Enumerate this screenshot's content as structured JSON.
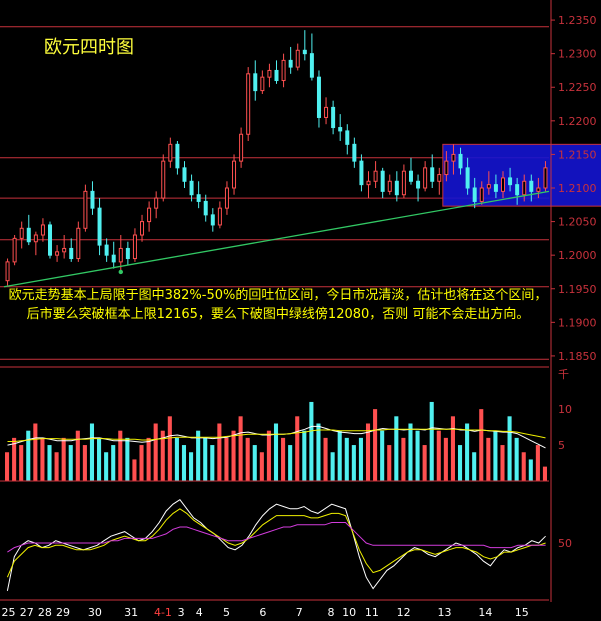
{
  "title": "欧元四时图",
  "commentary": "欧元走势基本上局限于图中382%-50%的回吐位区间，今日市况清淡，估计也将在这个区间，后市要么突破框本上限12165，要么下破图中绿线傍12080，否则 可能不会走出方向。",
  "colors": {
    "background": "#000000",
    "axis": "#c8323c",
    "up": "#ff5050",
    "down": "#50f0f0",
    "box_fill": "#1414d2",
    "trendline": "#32c864",
    "circles": "#f5e68c",
    "text": "#ffff00",
    "osc_white": "#ffffff",
    "osc_yellow": "#f0f000",
    "osc_magenta": "#d23cdc"
  },
  "chart_data": [
    {
      "type": "candlestick",
      "panel": "price",
      "y_ticks": [
        "1.2350",
        "1.2300",
        "1.2250",
        "1.2200",
        "1.2150",
        "1.2100",
        "1.2050",
        "1.2000",
        "1.1950",
        "1.1900",
        "1.1850"
      ],
      "ylim": [
        1.1835,
        1.2365
      ],
      "horizontal_levels": [
        1.234,
        1.2145,
        1.2085,
        1.2023,
        1.1953,
        1.1845
      ],
      "range_box": {
        "top": 1.2165,
        "bottom": 1.2073,
        "x_start": 61.5,
        "x_end": 87.5
      },
      "trendline": {
        "start": [
          0,
          1.1953
        ],
        "end": [
          100,
          1.2095
        ]
      },
      "trendline_point": [
        16,
        1.1975
      ],
      "circles": [
        [
          87.5,
          1.217
        ],
        [
          87.5,
          1.2075
        ]
      ],
      "candles": [
        [
          1.1962,
          1.1995,
          1.1955,
          1.199
        ],
        [
          1.199,
          1.203,
          1.1985,
          1.2025
        ],
        [
          1.2025,
          1.205,
          1.201,
          1.204
        ],
        [
          1.204,
          1.206,
          1.2015,
          1.202
        ],
        [
          1.202,
          1.2035,
          1.2,
          1.203
        ],
        [
          1.203,
          1.2055,
          1.202,
          1.2045
        ],
        [
          1.2045,
          1.205,
          1.1995,
          1.2
        ],
        [
          1.2,
          1.2015,
          1.199,
          1.2005
        ],
        [
          1.2005,
          1.203,
          1.1995,
          1.201
        ],
        [
          1.201,
          1.2025,
          1.199,
          1.1995
        ],
        [
          1.1995,
          1.205,
          1.199,
          1.204
        ],
        [
          1.204,
          1.2105,
          1.2035,
          1.2095
        ],
        [
          1.2095,
          1.211,
          1.206,
          1.207
        ],
        [
          1.207,
          1.2085,
          1.2,
          1.2015
        ],
        [
          1.2015,
          1.2025,
          1.199,
          1.2
        ],
        [
          1.2,
          1.202,
          1.198,
          1.199
        ],
        [
          1.199,
          1.203,
          1.1975,
          1.201
        ],
        [
          1.201,
          1.202,
          1.1985,
          1.1995
        ],
        [
          1.1995,
          1.204,
          1.199,
          1.203
        ],
        [
          1.203,
          1.206,
          1.202,
          1.205
        ],
        [
          1.205,
          1.208,
          1.2035,
          1.207
        ],
        [
          1.207,
          1.2095,
          1.2055,
          1.2085
        ],
        [
          1.2085,
          1.215,
          1.208,
          1.214
        ],
        [
          1.214,
          1.2175,
          1.213,
          1.2165
        ],
        [
          1.2165,
          1.217,
          1.212,
          1.213
        ],
        [
          1.213,
          1.214,
          1.21,
          1.211
        ],
        [
          1.211,
          1.212,
          1.208,
          1.209
        ],
        [
          1.209,
          1.211,
          1.207,
          1.208
        ],
        [
          1.208,
          1.209,
          1.205,
          1.206
        ],
        [
          1.206,
          1.207,
          1.2035,
          1.2045
        ],
        [
          1.2045,
          1.208,
          1.204,
          1.207
        ],
        [
          1.207,
          1.211,
          1.206,
          1.21
        ],
        [
          1.21,
          1.215,
          1.209,
          1.214
        ],
        [
          1.214,
          1.219,
          1.213,
          1.218
        ],
        [
          1.218,
          1.228,
          1.217,
          1.227
        ],
        [
          1.227,
          1.229,
          1.223,
          1.2245
        ],
        [
          1.2245,
          1.2275,
          1.224,
          1.2265
        ],
        [
          1.2265,
          1.2285,
          1.225,
          1.2275
        ],
        [
          1.2275,
          1.229,
          1.2255,
          1.226
        ],
        [
          1.226,
          1.23,
          1.225,
          1.229
        ],
        [
          1.229,
          1.231,
          1.227,
          1.228
        ],
        [
          1.228,
          1.2315,
          1.2275,
          1.2305
        ],
        [
          1.2305,
          1.2335,
          1.229,
          1.23
        ],
        [
          1.23,
          1.233,
          1.226,
          1.2265
        ],
        [
          1.2265,
          1.2275,
          1.219,
          1.2205
        ],
        [
          1.2205,
          1.2235,
          1.2195,
          1.222
        ],
        [
          1.222,
          1.223,
          1.218,
          1.219
        ],
        [
          1.219,
          1.221,
          1.217,
          1.2185
        ],
        [
          1.2185,
          1.2195,
          1.215,
          1.2165
        ],
        [
          1.2165,
          1.2175,
          1.213,
          1.214
        ],
        [
          1.214,
          1.215,
          1.2095,
          1.2105
        ],
        [
          1.2105,
          1.2125,
          1.2085,
          1.211
        ],
        [
          1.211,
          1.214,
          1.21,
          1.2125
        ],
        [
          1.2125,
          1.213,
          1.2085,
          1.2095
        ],
        [
          1.2095,
          1.212,
          1.209,
          1.211
        ],
        [
          1.211,
          1.2125,
          1.208,
          1.209
        ],
        [
          1.209,
          1.2135,
          1.2085,
          1.2125
        ],
        [
          1.2125,
          1.2145,
          1.2105,
          1.211
        ],
        [
          1.211,
          1.212,
          1.208,
          1.21
        ],
        [
          1.21,
          1.214,
          1.2095,
          1.213
        ],
        [
          1.213,
          1.215,
          1.21,
          1.211
        ],
        [
          1.211,
          1.213,
          1.209,
          1.212
        ],
        [
          1.212,
          1.2155,
          1.211,
          1.214
        ],
        [
          1.214,
          1.2165,
          1.212,
          1.215
        ],
        [
          1.215,
          1.216,
          1.212,
          1.213
        ],
        [
          1.213,
          1.2145,
          1.209,
          1.21
        ],
        [
          1.21,
          1.2115,
          1.207,
          1.208
        ],
        [
          1.208,
          1.211,
          1.2075,
          1.21
        ],
        [
          1.21,
          1.2125,
          1.209,
          1.2105
        ],
        [
          1.2105,
          1.212,
          1.2085,
          1.2095
        ],
        [
          1.2095,
          1.2125,
          1.2085,
          1.2115
        ],
        [
          1.2115,
          1.213,
          1.2095,
          1.2105
        ],
        [
          1.2105,
          1.2115,
          1.2075,
          1.209
        ],
        [
          1.209,
          1.212,
          1.208,
          1.211
        ],
        [
          1.211,
          1.212,
          1.208,
          1.2095
        ],
        [
          1.2095,
          1.2115,
          1.2085,
          1.21
        ],
        [
          1.21,
          1.214,
          1.2095,
          1.213
        ]
      ]
    },
    {
      "type": "bar",
      "panel": "volume",
      "y_ticks": [
        "千",
        "10",
        "5"
      ],
      "ylim": [
        0,
        16
      ],
      "values": [
        4,
        6,
        5,
        7,
        8,
        6,
        5,
        4,
        6,
        5,
        7,
        5,
        8,
        6,
        4,
        5,
        7,
        6,
        3,
        5,
        6,
        8,
        7,
        9,
        6,
        5,
        4,
        7,
        6,
        5,
        8,
        6,
        7,
        9,
        6,
        5,
        4,
        7,
        8,
        6,
        5,
        9,
        7,
        11,
        8,
        6,
        4,
        7,
        6,
        5,
        6,
        8,
        10,
        7,
        5,
        9,
        6,
        8,
        7,
        5,
        11,
        7,
        6,
        9,
        5,
        8,
        4,
        10,
        6,
        7,
        5,
        9,
        6,
        4,
        3,
        5,
        2
      ],
      "ma_white": [
        5,
        5.2,
        5.5,
        5.8,
        6,
        6,
        5.8,
        5.6,
        5.6,
        5.6,
        5.8,
        5.9,
        6,
        6,
        5.8,
        5.6,
        5.6,
        5.6,
        5.5,
        5.4,
        5.5,
        5.8,
        6,
        6.3,
        6.4,
        6.2,
        6,
        6,
        6,
        5.9,
        6,
        6.1,
        6.4,
        6.7,
        6.8,
        6.6,
        6.4,
        6.4,
        6.5,
        6.5,
        6.6,
        6.9,
        7.2,
        7.6,
        7.6,
        7.3,
        7,
        6.8,
        6.7,
        6.6,
        6.6,
        6.8,
        7.1,
        7.3,
        7.2,
        7.2,
        7.1,
        7.2,
        7.2,
        7.1,
        7.4,
        7.3,
        7.2,
        7.3,
        7.1,
        7.1,
        6.9,
        7.1,
        7,
        6.9,
        6.8,
        6.8,
        6.6,
        6.1,
        5.6,
        5.1,
        4.6
      ],
      "ma_yellow": [
        5.5,
        5.5,
        5.6,
        5.7,
        5.8,
        5.9,
        5.9,
        5.9,
        5.8,
        5.8,
        5.8,
        5.8,
        5.9,
        5.9,
        5.9,
        5.8,
        5.8,
        5.8,
        5.8,
        5.7,
        5.7,
        5.8,
        5.9,
        6,
        6.1,
        6.1,
        6.1,
        6.1,
        6.1,
        6.1,
        6.1,
        6.2,
        6.3,
        6.4,
        6.5,
        6.5,
        6.5,
        6.5,
        6.5,
        6.5,
        6.6,
        6.7,
        6.8,
        7,
        7.1,
        7.1,
        7.1,
        7,
        7,
        7,
        7,
        7,
        7.1,
        7.1,
        7.2,
        7.2,
        7.2,
        7.2,
        7.2,
        7.2,
        7.2,
        7.2,
        7.2,
        7.2,
        7.2,
        7.1,
        7.1,
        7.1,
        7,
        7,
        6.9,
        6.9,
        6.8,
        6.6,
        6.4,
        6.2,
        6
      ]
    },
    {
      "type": "line",
      "panel": "oscillator",
      "y_ticks": [
        "50"
      ],
      "ylim": [
        0,
        100
      ],
      "x_tick_labels": [
        "25",
        "27",
        "28",
        "29",
        "30",
        "31",
        "4-1",
        "3",
        "4",
        "5",
        "6",
        "7",
        "8",
        "10",
        "11",
        "12",
        "13",
        "14",
        "15"
      ],
      "x_tick_positions": [
        1,
        5,
        9,
        13,
        20,
        28,
        35,
        39,
        43,
        49,
        57,
        65,
        72,
        76,
        81,
        88,
        97,
        106,
        114
      ],
      "series": [
        {
          "values": [
            8,
            38,
            48,
            52,
            50,
            46,
            48,
            52,
            50,
            48,
            46,
            44,
            46,
            48,
            52,
            56,
            58,
            60,
            56,
            52,
            54,
            60,
            68,
            78,
            84,
            88,
            80,
            72,
            68,
            62,
            58,
            52,
            46,
            44,
            48,
            56,
            66,
            74,
            80,
            84,
            82,
            80,
            80,
            82,
            78,
            76,
            80,
            84,
            82,
            80,
            60,
            38,
            20,
            10,
            18,
            26,
            30,
            36,
            42,
            46,
            44,
            40,
            38,
            42,
            46,
            50,
            48,
            44,
            40,
            34,
            30,
            38,
            44,
            42,
            46,
            48,
            52,
            50,
            56
          ]
        },
        {
          "values": [
            20,
            34,
            40,
            46,
            48,
            46,
            46,
            48,
            48,
            46,
            44,
            44,
            44,
            46,
            48,
            52,
            54,
            56,
            54,
            52,
            52,
            56,
            62,
            70,
            76,
            80,
            76,
            70,
            66,
            62,
            58,
            54,
            50,
            48,
            50,
            54,
            60,
            66,
            70,
            74,
            74,
            74,
            74,
            74,
            72,
            72,
            74,
            76,
            76,
            74,
            60,
            44,
            32,
            24,
            26,
            30,
            34,
            38,
            42,
            44,
            44,
            42,
            40,
            42,
            44,
            46,
            46,
            44,
            42,
            38,
            36,
            38,
            42,
            42,
            44,
            46,
            48,
            48,
            50
          ]
        },
        {
          "values": [
            42,
            46,
            48,
            50,
            50,
            50,
            50,
            50,
            50,
            50,
            50,
            50,
            50,
            50,
            50,
            52,
            52,
            54,
            54,
            54,
            54,
            54,
            56,
            58,
            62,
            64,
            64,
            62,
            60,
            58,
            56,
            54,
            52,
            52,
            52,
            54,
            56,
            58,
            60,
            62,
            64,
            64,
            66,
            66,
            66,
            66,
            66,
            68,
            68,
            68,
            62,
            56,
            50,
            48,
            48,
            48,
            48,
            48,
            48,
            48,
            48,
            48,
            48,
            48,
            48,
            48,
            48,
            48,
            48,
            48,
            46,
            46,
            46,
            46,
            48,
            48,
            48,
            48,
            48
          ]
        }
      ]
    }
  ]
}
